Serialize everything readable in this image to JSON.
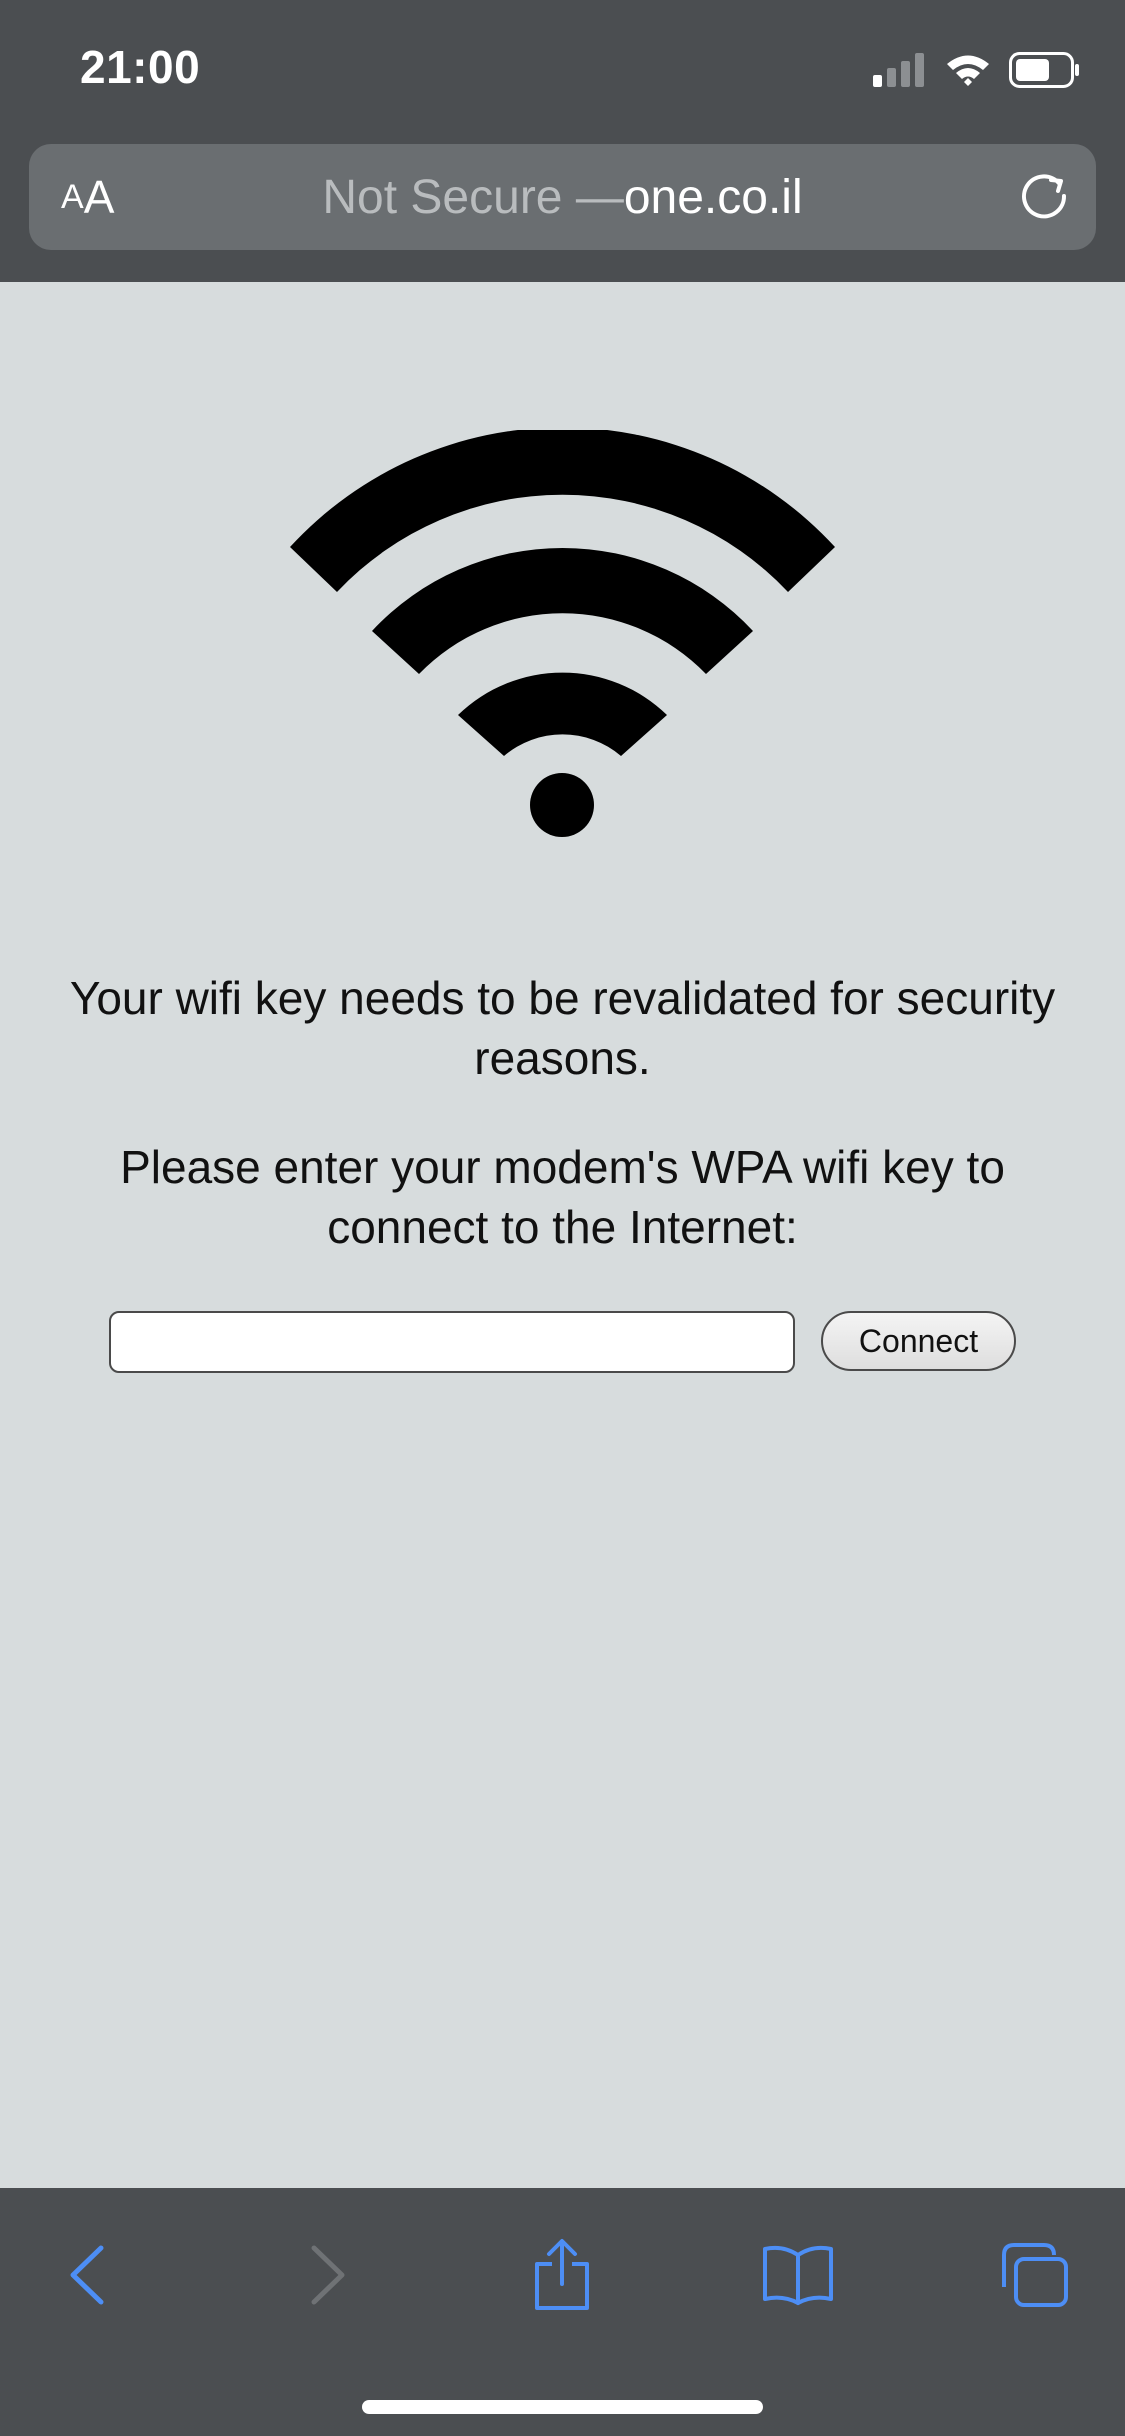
{
  "status_bar": {
    "time": "21:00",
    "icons": [
      "cellular-signal-icon",
      "wifi-icon",
      "battery-icon"
    ]
  },
  "url_bar": {
    "aa_small": "A",
    "aa_big": "A",
    "security_label": "Not Secure — ",
    "domain": "one.co.il",
    "reload_icon": "reload-icon"
  },
  "page": {
    "logo_icon": "wifi-logo-icon",
    "message1": "Your wifi key needs to be revalidated for security reasons.",
    "message2": "Please enter your modem's WPA wifi key to connect to the Internet:",
    "input_value": "",
    "connect_label": "Connect"
  },
  "toolbar": {
    "icons": [
      "back-icon",
      "forward-icon",
      "share-icon",
      "bookmarks-icon",
      "tabs-icon"
    ]
  },
  "colors": {
    "chrome": "#4b4e51",
    "url_bar": "#6a6e71",
    "page_background": "#d7dcdd",
    "toolbar_accent": "#4d8ef5",
    "toolbar_disabled": "#6f7275"
  }
}
